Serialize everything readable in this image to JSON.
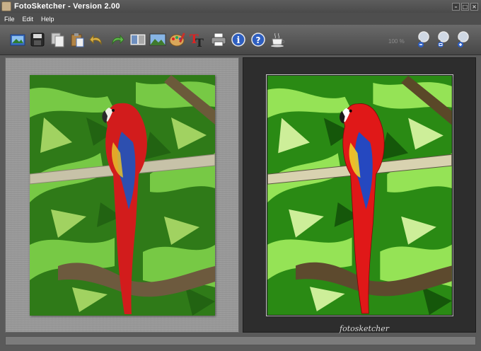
{
  "window": {
    "title": "FotoSketcher - Version 2.00",
    "minimize_glyph": "–",
    "maximize_glyph": "□",
    "close_glyph": "×"
  },
  "menu": [
    "File",
    "Edit",
    "Help"
  ],
  "toolbar": {
    "buttons": [
      "open-image-icon",
      "save-icon",
      "copy-icon",
      "paste-icon",
      "undo-icon",
      "redo-icon",
      "drawing-parameters-icon",
      "landscape-icon",
      "palette-icon",
      "text-icon",
      "print-icon",
      "info-icon",
      "help-icon",
      "coffee-donate-icon"
    ],
    "zoom_value": "100 %",
    "zoom_buttons": [
      "zoom-out-icon",
      "zoom-fit-icon",
      "zoom-in-icon"
    ]
  },
  "output": {
    "signature": "fotosketcher"
  },
  "colors": {
    "parrot_red": "#d21c1c",
    "leaf_green": "#3c9b1e",
    "panel_dark": "#2d2d2d"
  }
}
